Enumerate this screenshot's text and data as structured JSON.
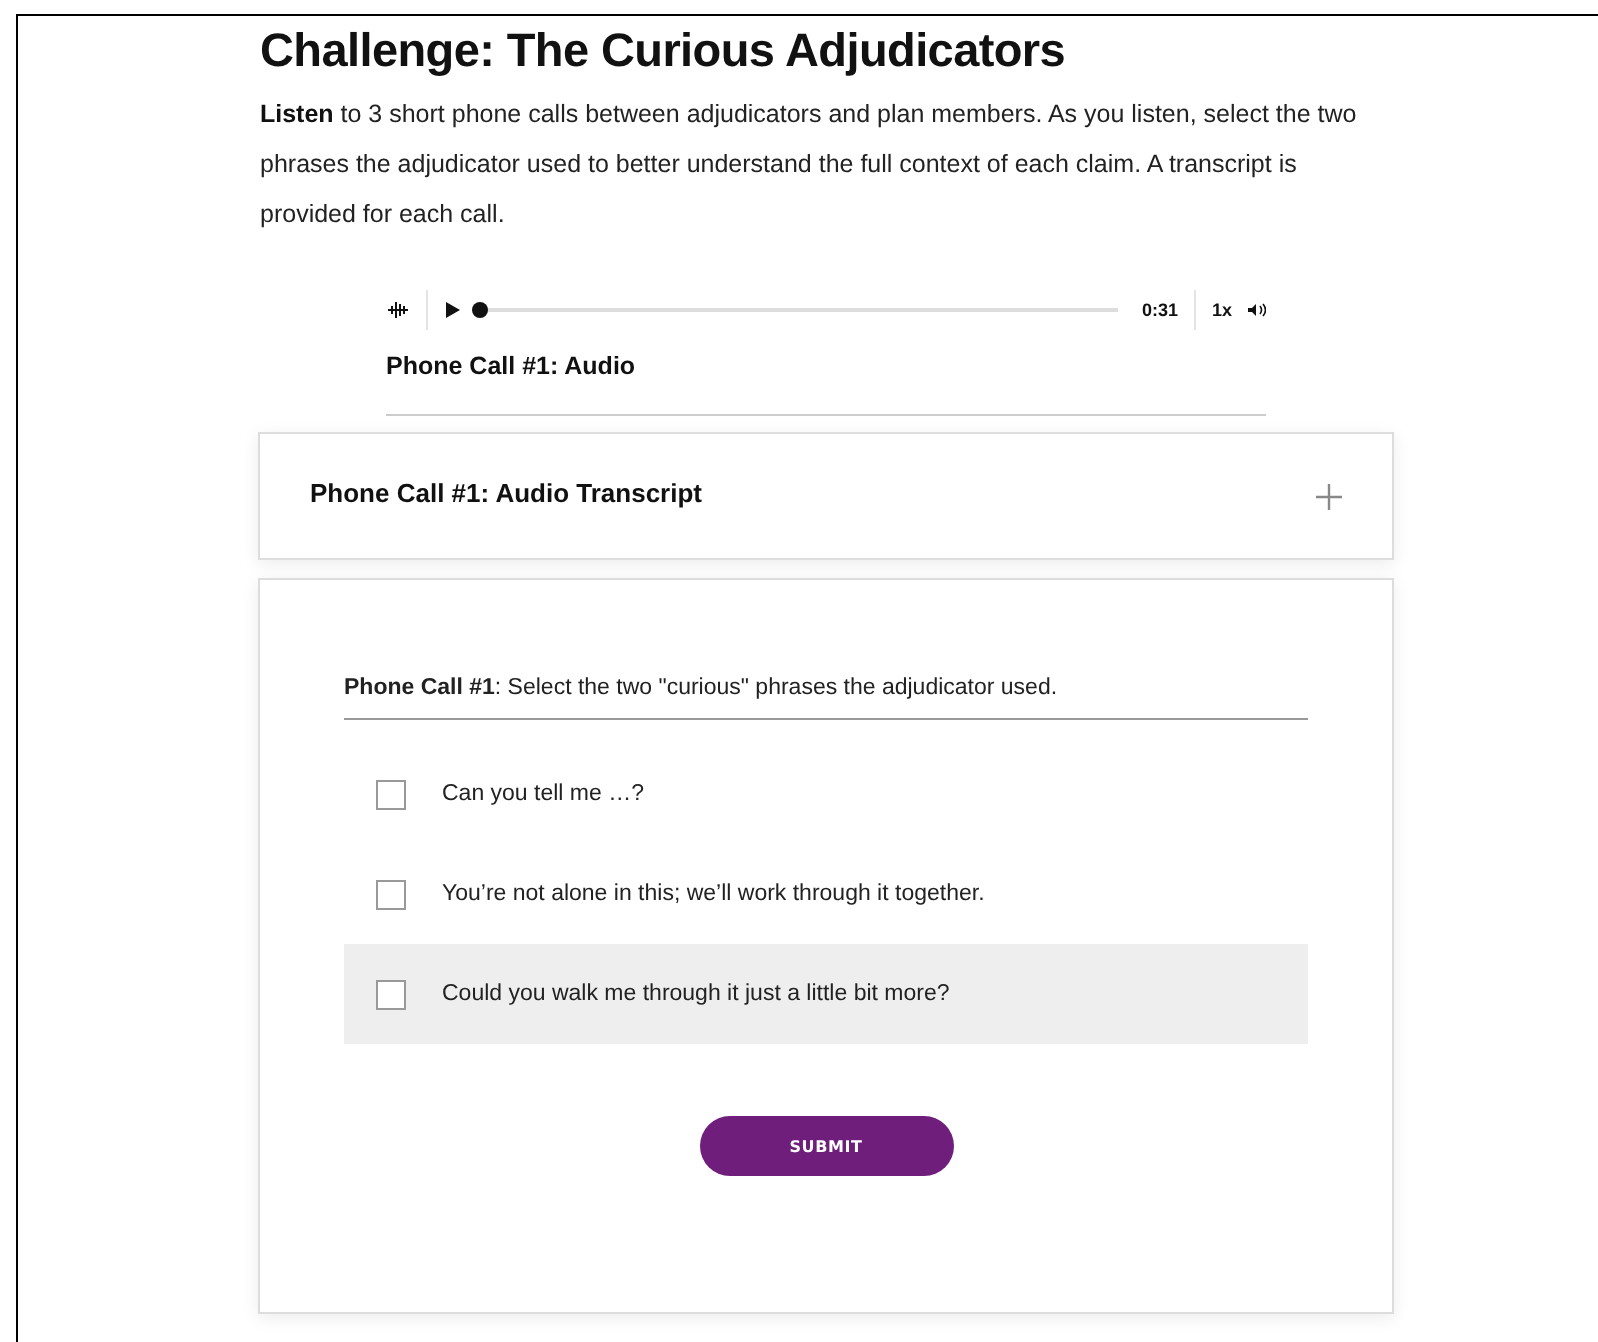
{
  "title": "Challenge: The Curious Adjudicators",
  "intro": "**Listen** to 3 short phone calls between adjudicators and plan members. As you listen, select the two phrases the adjudicator used to better understand the full context of each claim. A transcript is provided for each call.",
  "audio": {
    "level": 0,
    "time": "0:31",
    "speed": "1x",
    "caption": "Phone Call #1: Audio"
  },
  "transcript": {
    "title": "Phone Call #1: Audio Transcript",
    "expanded": false
  },
  "question": {
    "prompt": "**Phone Call #1**: Select the two \"curious\" phrases the adjudicator used.",
    "options": [
      {
        "label": "Can you tell me …?",
        "checked": false,
        "hovered": false
      },
      {
        "label": "You’re not alone in this; we’ll work through it together.",
        "checked": false,
        "hovered": false
      },
      {
        "label": "Could you walk me through it just a little bit more?",
        "checked": false,
        "hovered": true
      }
    ],
    "submit": "SUBMIT"
  }
}
